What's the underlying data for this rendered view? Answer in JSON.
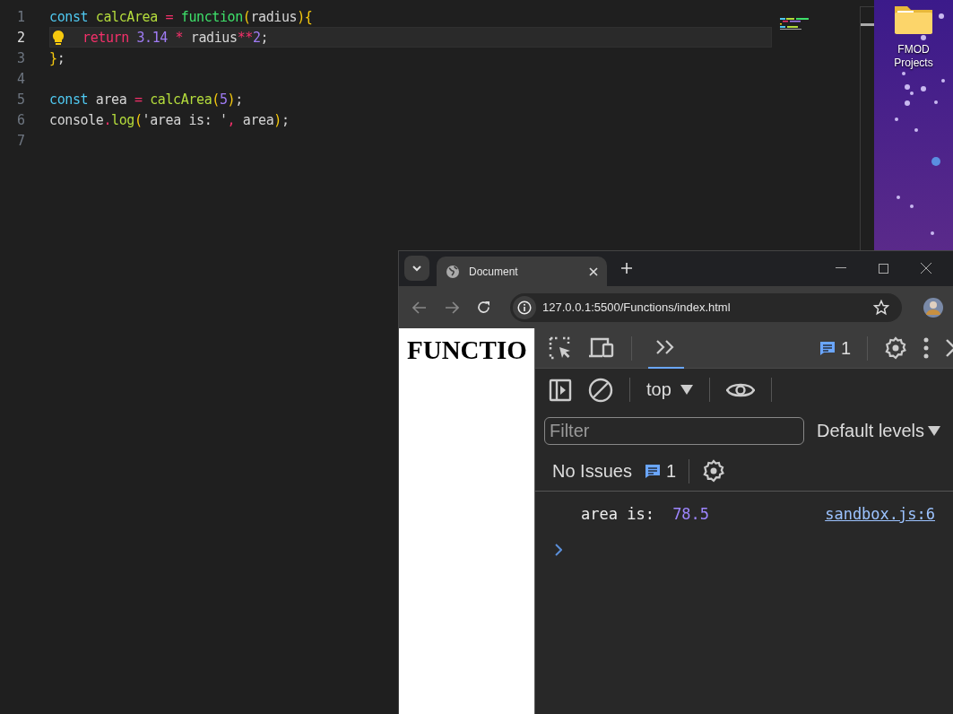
{
  "editor": {
    "lines": [
      {
        "number": "1",
        "current": false,
        "tokens": [
          {
            "kind": "decl",
            "text": "const "
          },
          {
            "kind": "name",
            "text": "calcArea "
          },
          {
            "kind": "op",
            "text": "= "
          },
          {
            "kind": "func",
            "text": "function"
          },
          {
            "kind": "paren",
            "text": "("
          },
          {
            "kind": "plain",
            "text": "radius"
          },
          {
            "kind": "paren",
            "text": "){"
          }
        ]
      },
      {
        "number": "2",
        "current": true,
        "tokens": [
          {
            "kind": "keyword",
            "text": "return "
          },
          {
            "kind": "number",
            "text": "3.14 "
          },
          {
            "kind": "op",
            "text": "* "
          },
          {
            "kind": "plain",
            "text": "radius"
          },
          {
            "kind": "op",
            "text": "**"
          },
          {
            "kind": "number",
            "text": "2"
          },
          {
            "kind": "plain",
            "text": ";"
          }
        ]
      },
      {
        "number": "3",
        "current": false,
        "tokens": [
          {
            "kind": "paren",
            "text": "}"
          },
          {
            "kind": "plain",
            "text": ";"
          }
        ]
      },
      {
        "number": "4",
        "current": false
      },
      {
        "number": "5",
        "current": false,
        "tokens": [
          {
            "kind": "decl",
            "text": "const "
          },
          {
            "kind": "plain",
            "text": "area "
          },
          {
            "kind": "op",
            "text": "= "
          },
          {
            "kind": "name",
            "text": "calcArea"
          },
          {
            "kind": "paren",
            "text": "("
          },
          {
            "kind": "number",
            "text": "5"
          },
          {
            "kind": "paren",
            "text": ")"
          },
          {
            "kind": "plain",
            "text": ";"
          }
        ]
      },
      {
        "number": "6",
        "current": false,
        "tokens": [
          {
            "kind": "plain",
            "text": "console"
          },
          {
            "kind": "op",
            "text": "."
          },
          {
            "kind": "name",
            "text": "log"
          },
          {
            "kind": "paren",
            "text": "("
          },
          {
            "kind": "plain",
            "text": "'area is: '"
          },
          {
            "kind": "op",
            "text": ","
          },
          {
            "kind": "plain",
            "text": " area"
          },
          {
            "kind": "paren",
            "text": ")"
          },
          {
            "kind": "plain",
            "text": ";"
          }
        ]
      },
      {
        "number": "7",
        "current": false
      }
    ]
  },
  "desktop_icons": [
    {
      "label": "FMOD Projects"
    }
  ],
  "browser": {
    "tab": {
      "title": "Document"
    },
    "address": "127.0.0.1:5500/Functions/index.html",
    "page": {
      "heading": "FUNCTIO"
    },
    "devtools": {
      "message_count": "1",
      "context": "top",
      "filter": {
        "placeholder": "Filter"
      },
      "levels": "Default levels",
      "issues": "No Issues",
      "issues_count": "1",
      "console": [
        {
          "label": "area is: ",
          "value": "78.5",
          "source": "sandbox.js:6"
        }
      ]
    }
  }
}
